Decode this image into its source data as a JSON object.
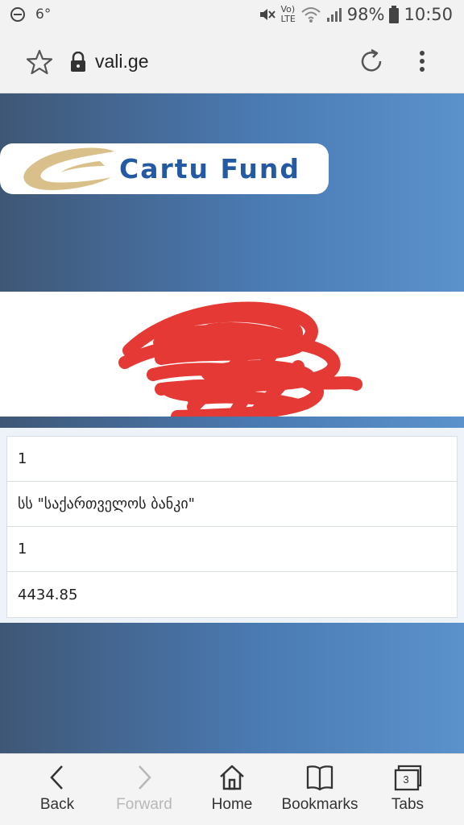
{
  "status_bar": {
    "temperature": "6°",
    "lte_label": "LTE",
    "volte_label": "Vo)",
    "battery": "98%",
    "time": "10:50"
  },
  "browser": {
    "url": "vali.ge",
    "icons": [
      "star-icon",
      "lock-icon",
      "reload-icon",
      "more-vert-icon"
    ]
  },
  "page": {
    "logo_text": "Cartu Fund",
    "table_rows": [
      "1",
      "სს \"საქართველოს ბანკი\"",
      "1",
      "4434.85"
    ]
  },
  "bottom_nav": {
    "back": "Back",
    "forward": "Forward",
    "home": "Home",
    "bookmarks": "Bookmarks",
    "tabs": "Tabs",
    "tabs_count": "3"
  },
  "colors": {
    "hero_gradient_start": "#3f5776",
    "hero_gradient_end": "#5b92cc",
    "logo_blue": "#245aa3",
    "logo_gold": "#d9c08a",
    "scribble_red": "#e53935"
  }
}
